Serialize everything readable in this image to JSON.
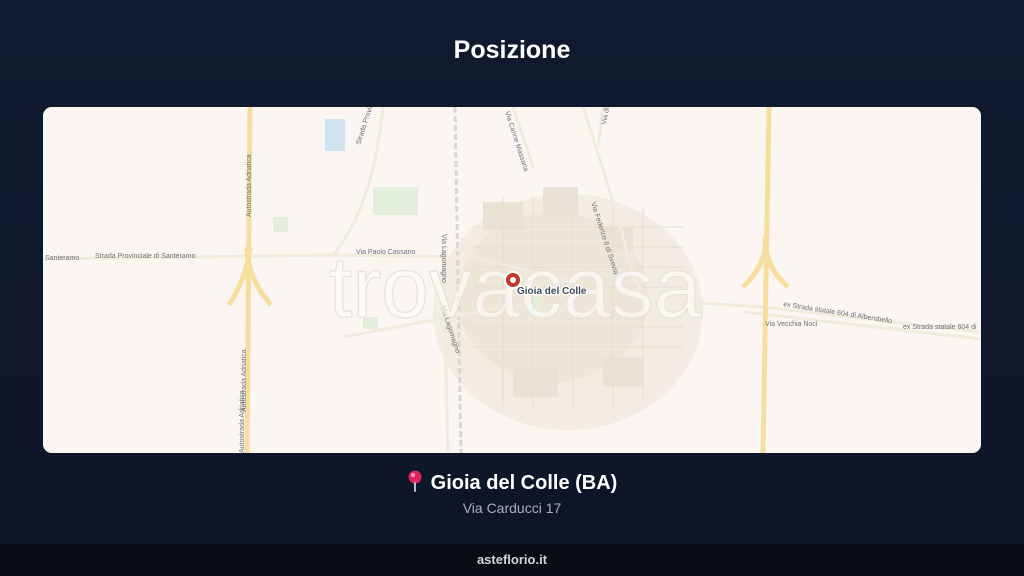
{
  "header": {
    "title": "Posizione"
  },
  "map": {
    "watermark": "trovacasa",
    "marker_label": "Gioia del Colle",
    "road_labels": {
      "santeramo": "Santeramo",
      "sp_santeramo": "Strada Provinciale di Santeramo",
      "paolo_cassano": "Via Paolo Cassano",
      "lagomagno_1": "Via Lagomagno",
      "lagomagno_2": "Via Lagomagno",
      "federico": "Via Federico II di Svevia",
      "strada_prov": "Strada Provinciale",
      "vecchia_noci": "Via Vecchia Noci",
      "ss604_1": "ex Strada statale 604 di Alberobello",
      "ss604_2": "ex Strada statale 604 di",
      "autostrada_1": "Autostrada Adriatica",
      "autostrada_2": "Autostrada Adriatica",
      "autostrada_3": "Autostrada Adriatica",
      "top_road": "Via Canne Massaria",
      "top_right": "Via di"
    }
  },
  "location": {
    "pin_icon": "map-pin-icon",
    "city": "Gioia del Colle (BA)",
    "address": "Via Carducci 17"
  },
  "footer": {
    "site": "asteflorio.it"
  },
  "colors": {
    "background": "#0f1a2e",
    "map_base": "#fbf6f1",
    "highway": "#f6df9e",
    "marker": "#c0392b",
    "footer_bg": "#080d17"
  }
}
